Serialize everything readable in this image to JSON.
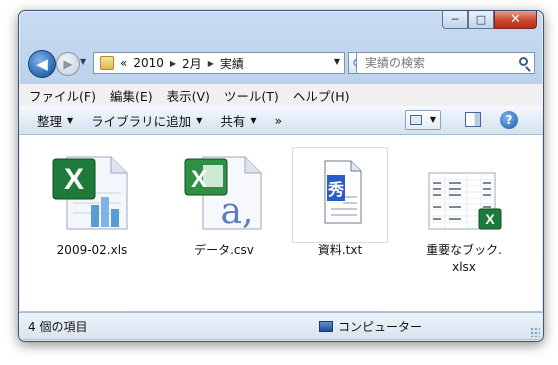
{
  "window": {
    "caption": {
      "minimize": "─",
      "maximize": "□",
      "close": "✕"
    }
  },
  "nav": {
    "back_glyph": "◀",
    "forward_glyph": "▶",
    "breadcrumbs": [
      "«",
      "2010",
      "2月",
      "実績"
    ],
    "search_placeholder": "実績の検索"
  },
  "menu": [
    "ファイル(F)",
    "編集(E)",
    "表示(V)",
    "ツール(T)",
    "ヘルプ(H)"
  ],
  "commands": {
    "organize": "整理",
    "library": "ライブラリに追加",
    "share": "共有",
    "more": "»"
  },
  "files": [
    {
      "name": "2009-02.xls",
      "icon": "excel-xls-icon"
    },
    {
      "name": "データ.csv",
      "icon": "excel-csv-icon"
    },
    {
      "name": "資料.txt",
      "icon": "text-file-icon"
    },
    {
      "name": "重要なブック.\nxlsx",
      "icon": "xlsx-thumbnail-icon"
    }
  ],
  "status": {
    "count": "4 個の項目",
    "location": "コンピューター"
  },
  "colors": {
    "excel_green": "#1d7a3a",
    "accent_blue": "#2767b4"
  }
}
